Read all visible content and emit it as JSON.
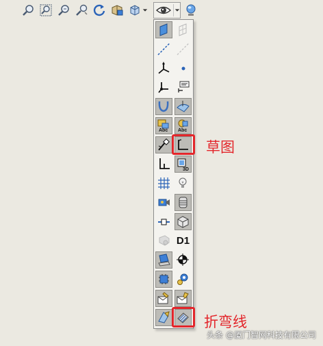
{
  "toolbar": {
    "icons": [
      "zoom-to-fit-icon",
      "zoom-to-area-icon",
      "zoom-in-out-icon",
      "zoom-selection-icon",
      "rotate-view-icon",
      "section-view-icon",
      "view-orientation-icon",
      "hide-show-items-icon",
      "appearance-globe-icon"
    ]
  },
  "callouts": {
    "sketch": "草图",
    "bend_lines": "折弯线"
  },
  "watermark": "头条 @厦门智网科技有限公司",
  "panel": {
    "d1_label": "D1",
    "highlight_color": "#e3262b"
  }
}
